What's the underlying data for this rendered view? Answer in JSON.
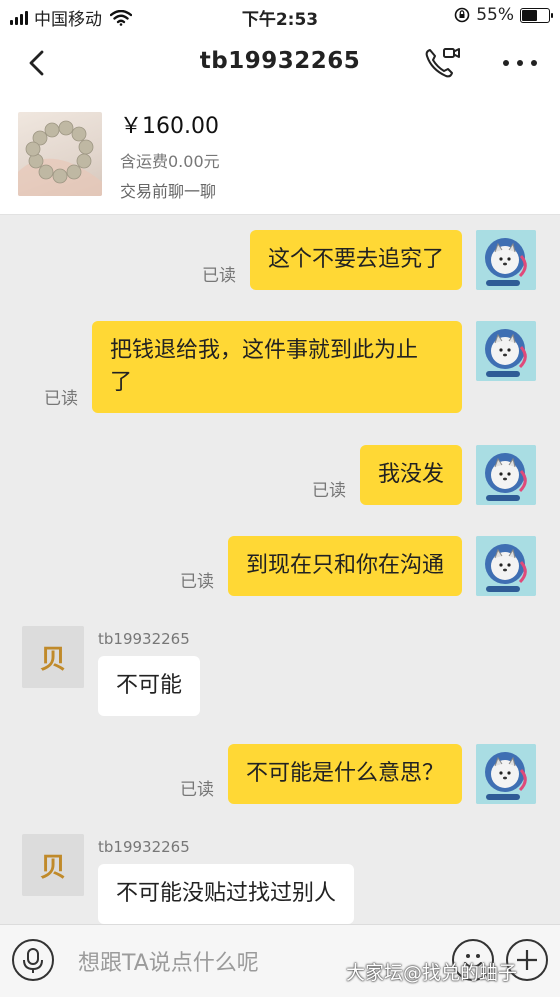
{
  "status_bar": {
    "carrier": "中国移动",
    "time": "下午2:53",
    "battery": "55%",
    "battery_level": 0.55
  },
  "header": {
    "title": "tb19932265",
    "back_icon": "chevron-left-icon",
    "call_icon": "phone-video-icon",
    "more_icon": "more-dots-icon"
  },
  "product": {
    "price": "￥160.00",
    "shipping": "含运费0.00元",
    "note": "交易前聊一聊"
  },
  "messages": [
    {
      "side": "out",
      "read": "已读",
      "text": "这个不要去追究了"
    },
    {
      "side": "out",
      "read": "已读",
      "line1": "把钱退给我，这件事就到此为止",
      "line2": "了"
    },
    {
      "side": "out",
      "read": "已读",
      "text": "我没发"
    },
    {
      "side": "out",
      "read": "已读",
      "text": "到现在只和你在沟通"
    },
    {
      "side": "in",
      "sender": "tb19932265",
      "text": "不可能"
    },
    {
      "side": "out",
      "read": "已读",
      "text": "不可能是什么意思？"
    },
    {
      "side": "in",
      "sender": "tb19932265",
      "text": "不可能没贴过找过别人"
    }
  ],
  "input": {
    "placeholder": "想跟TA说点什么呢"
  },
  "watermark": "大家坛@找兑的蛐子",
  "colors": {
    "bubble_out": "#ffd835",
    "bubble_in": "#ffffff",
    "chat_bg": "#ececec"
  }
}
